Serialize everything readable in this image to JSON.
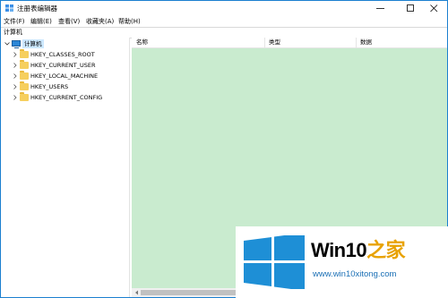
{
  "window": {
    "title": "注册表编辑器",
    "minimize_icon": "minimize-icon",
    "maximize_icon": "maximize-icon",
    "close_icon": "close-icon"
  },
  "menubar": {
    "items": [
      "文件(F)",
      "编辑(E)",
      "查看(V)",
      "收藏夹(A)",
      "帮助(H)"
    ]
  },
  "address": {
    "path": "计算机"
  },
  "tree": {
    "root": "计算机",
    "items": [
      "HKEY_CLASSES_ROOT",
      "HKEY_CURRENT_USER",
      "HKEY_LOCAL_MACHINE",
      "HKEY_USERS",
      "HKEY_CURRENT_CONFIG"
    ]
  },
  "values_list": {
    "columns": [
      "名称",
      "类型",
      "数据"
    ],
    "background": "#c9ebcf"
  },
  "watermark": {
    "brand_main": "Win10",
    "brand_accent": "之家",
    "url": "www.win10xitong.com",
    "logo_color": "#1e8fd6",
    "accent_color": "#e8a200"
  }
}
